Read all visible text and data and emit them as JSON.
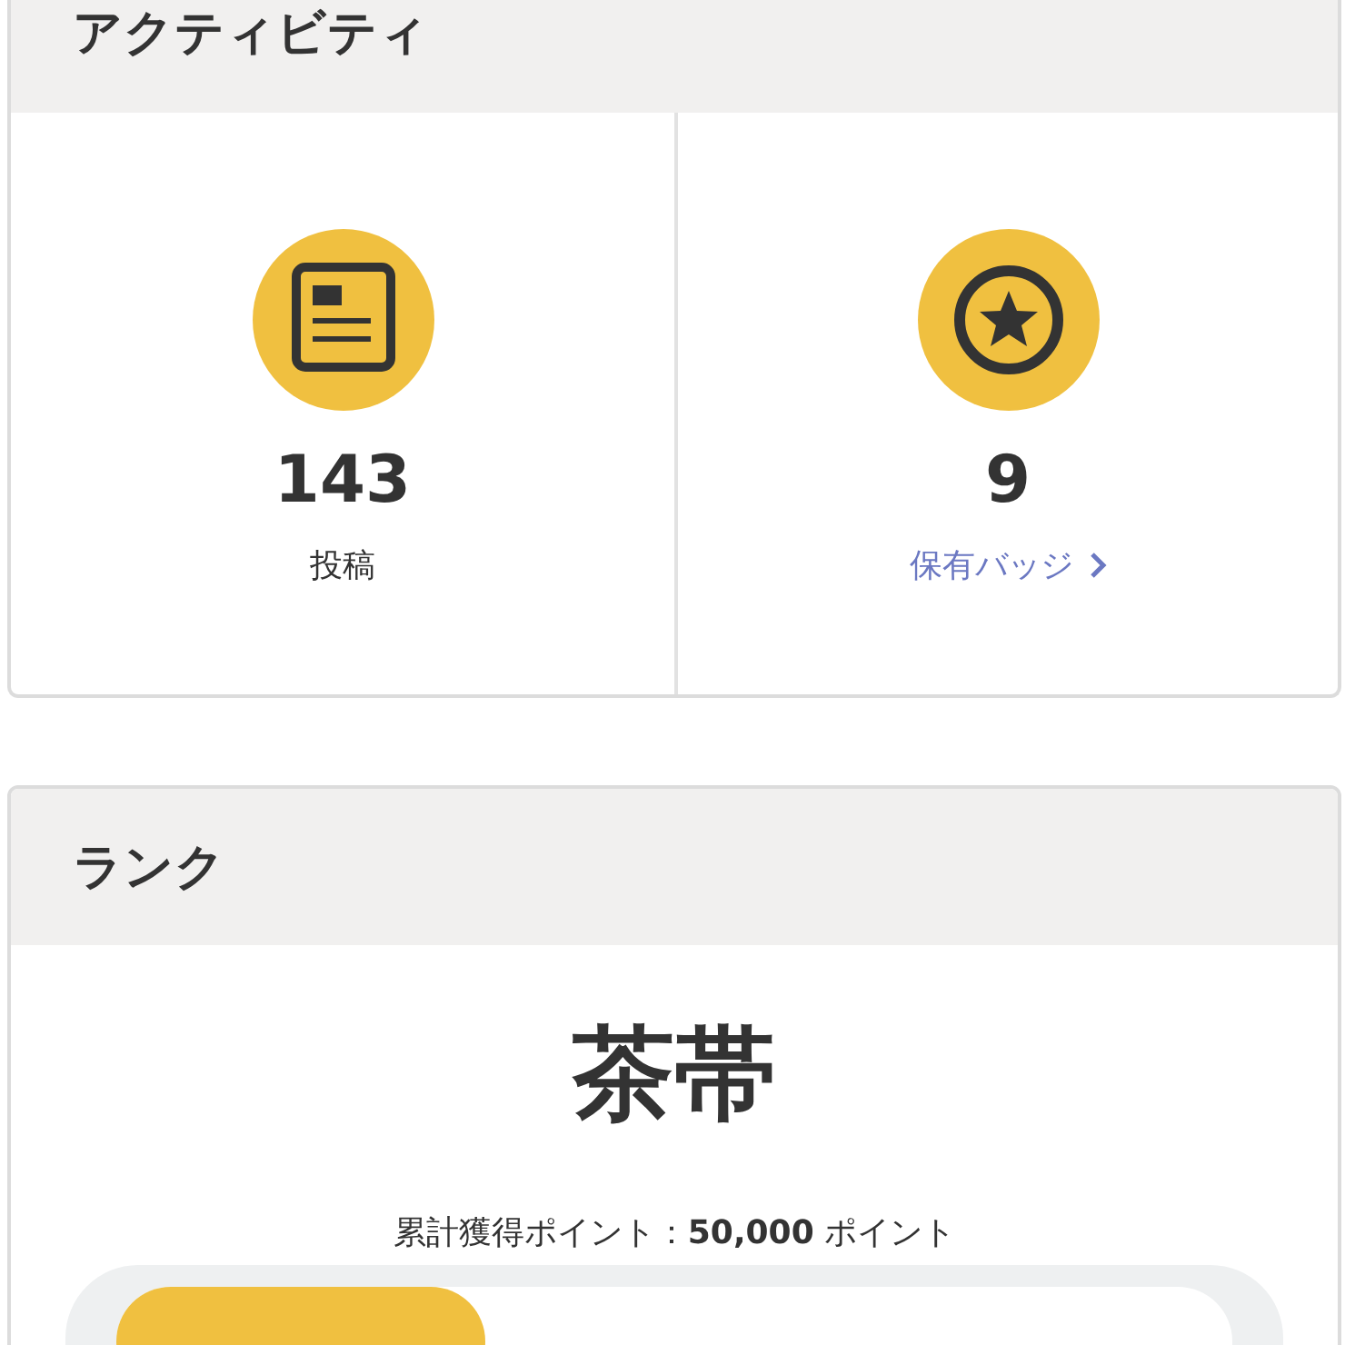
{
  "activity": {
    "title": "アクティビティ",
    "stats": [
      {
        "kind": "posts",
        "value": "143",
        "label": "投稿"
      },
      {
        "kind": "badges",
        "value": "9",
        "label": "保有バッジ"
      }
    ]
  },
  "rank": {
    "title": "ランク",
    "name": "茶帯",
    "points": "累計獲得ポイント：**50,000** ポイント",
    "level": 0.33
  }
}
